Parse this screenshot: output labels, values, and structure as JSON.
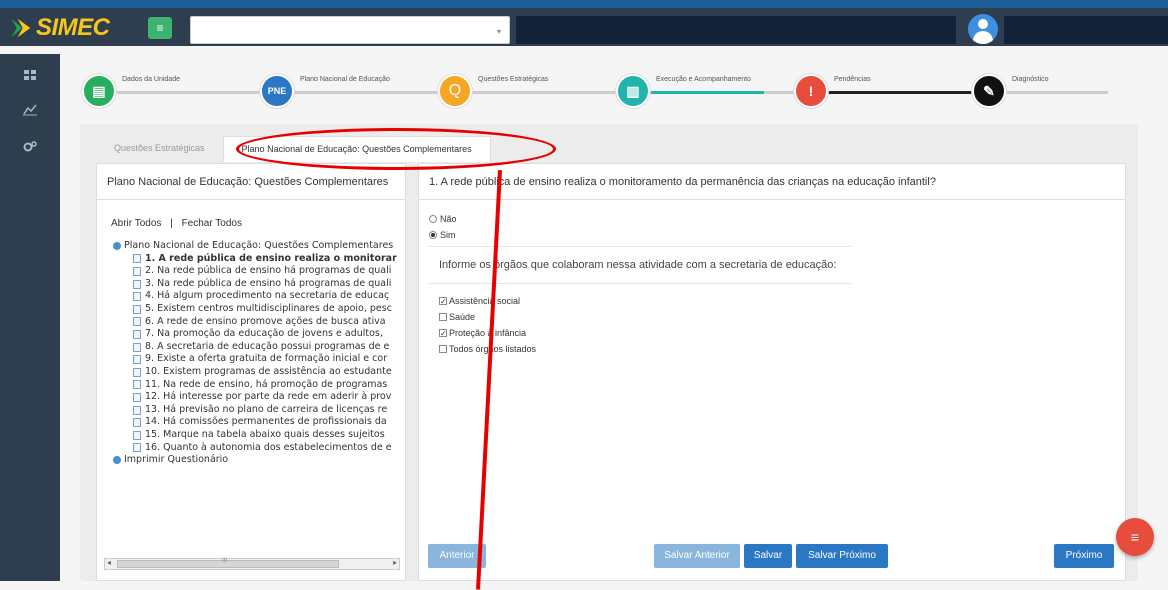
{
  "app": {
    "name": "SIMEC",
    "menu_icon": "≡"
  },
  "header": {
    "select_value": "",
    "select_caret": "▾"
  },
  "sidebar": {
    "icons": [
      "dashboard-icon",
      "chart-line-icon",
      "gears-icon"
    ]
  },
  "steps": [
    {
      "label": "Dados da Unidade",
      "color": "#27ae60",
      "symbol": "▤"
    },
    {
      "label": "Plano Nacional de Educação",
      "color": "#2a77c4",
      "symbol": "PNE"
    },
    {
      "label": "Questões Estratégicas",
      "color": "#f5a623",
      "symbol": "Q"
    },
    {
      "label": "Execução e Acompanhamento",
      "color": "#1fb5ad",
      "symbol": "▥"
    },
    {
      "label": "Pendências",
      "color": "#e74c3c",
      "symbol": "!"
    },
    {
      "label": "Diagnóstico",
      "color": "#111111",
      "symbol": "✎"
    }
  ],
  "tabs": [
    "Questões Estratégicas",
    "Plano Nacional de Educação: Questões Complementares"
  ],
  "left": {
    "title": "Plano Nacional de Educação: Questões Complementares",
    "open_all": "Abrir Todos",
    "sep": "|",
    "close_all": "Fechar Todos",
    "root": "Plano Nacional de Educação: Questões Complementares",
    "items": [
      "1. A rede pública de ensino realiza o monitorar",
      "2. Na rede pública de ensino há programas de quali",
      "3. Na rede pública de ensino há programas de quali",
      "4. Há algum procedimento na secretaria de educaç",
      "5. Existem centros multidisciplinares de apoio, pesc",
      "6. A rede de ensino promove ações de busca ativa",
      "7. Na promoção da educação de jovens e adultos,",
      "8. A secretaria de educação possui programas de e",
      "9. Existe a oferta gratuita de formação inicial e cor",
      "10. Existem programas de assistência ao estudante",
      "11. Na rede de ensino, há promoção de programas",
      "12. Há interesse por parte da rede em aderir à prov",
      "13. Há previsão no plano de carreira de licenças re",
      "14. Há comissões permanentes de profissionais da",
      "15. Marque na tabela abaixo quais desses sujeitos",
      "16. Quanto à autonomia dos estabelecimentos de e"
    ],
    "print": "Imprimir Questionário",
    "scroll_left": "◂",
    "scroll_grip": "III",
    "scroll_right": "▸"
  },
  "right": {
    "question": "1. A rede pública de ensino realiza o monitoramento da permanência das crianças na educação infantil?",
    "opt_no": "Não",
    "opt_yes": "Sim",
    "sub_question": "Informe os órgãos que colaboram nessa atividade com a secretaria de educação:",
    "checks": [
      {
        "label": "Assistência social",
        "checked": true
      },
      {
        "label": "Saúde",
        "checked": false
      },
      {
        "label": "Proteção à infância",
        "checked": true
      },
      {
        "label": "Todos órgãos listados",
        "checked": false
      }
    ]
  },
  "buttons": {
    "prev": "Anterior",
    "save_prev": "Salvar Anterior",
    "save": "Salvar",
    "save_next": "Salvar Próximo",
    "next": "Próximo"
  },
  "fab_icon": "≡"
}
